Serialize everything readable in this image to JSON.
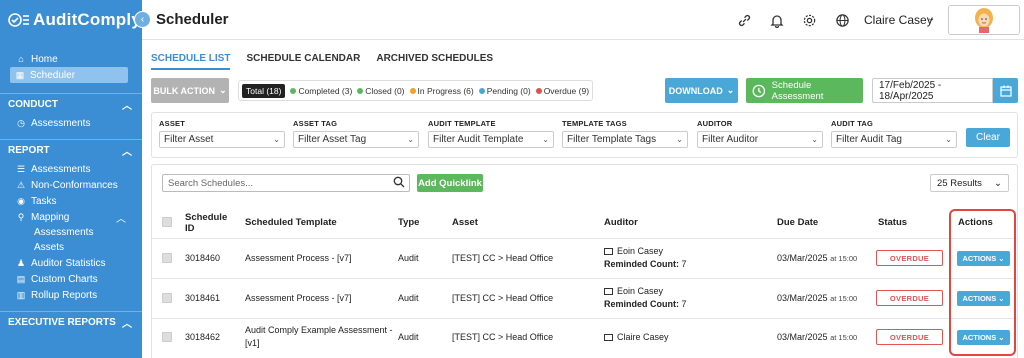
{
  "sidebar": {
    "brand": "AuditComply",
    "top_items": [
      {
        "label": "Home",
        "icon": "home-icon"
      },
      {
        "label": "Scheduler",
        "icon": "calendar-icon",
        "active": true
      }
    ],
    "conduct": {
      "title": "CONDUCT",
      "items": [
        {
          "label": "Assessments",
          "icon": "clock-icon"
        }
      ]
    },
    "report": {
      "title": "REPORT",
      "items": [
        {
          "label": "Assessments",
          "icon": "list-icon"
        },
        {
          "label": "Non-Conformances",
          "icon": "warning-icon"
        },
        {
          "label": "Tasks",
          "icon": "tasks-icon"
        },
        {
          "label": "Mapping",
          "icon": "map-pin-icon"
        }
      ],
      "mapping_sub": [
        "Assessments",
        "Assets"
      ],
      "items2": [
        {
          "label": "Auditor Statistics",
          "icon": "stats-icon"
        },
        {
          "label": "Custom Charts",
          "icon": "chart-icon"
        },
        {
          "label": "Rollup Reports",
          "icon": "rollup-icon"
        }
      ]
    },
    "executive": {
      "title": "EXECUTIVE REPORTS"
    }
  },
  "header": {
    "title": "Scheduler",
    "user_name": "Claire Casey"
  },
  "tabs": [
    "SCHEDULE LIST",
    "SCHEDULE CALENDAR",
    "ARCHIVED SCHEDULES"
  ],
  "toolbar": {
    "bulk_action": "BULK ACTION",
    "status": {
      "total": "Total (18)",
      "completed": "Completed (3)",
      "closed": "Closed (0)",
      "in_progress": "In Progress (6)",
      "pending": "Pending (0)",
      "overdue": "Overdue (9)"
    },
    "status_colors": {
      "completed": "#5cb85c",
      "closed": "#5cb85c",
      "in_progress": "#f0a030",
      "pending": "#4aa8d8",
      "overdue": "#d9534f"
    },
    "download": "DOWNLOAD",
    "schedule_assessment": "Schedule Assessment",
    "date_range": "17/Feb/2025 - 18/Apr/2025"
  },
  "filters": {
    "asset": {
      "label": "ASSET",
      "placeholder": "Filter Asset"
    },
    "asset_tag": {
      "label": "ASSET TAG",
      "placeholder": "Filter Asset Tag"
    },
    "audit_template": {
      "label": "AUDIT TEMPLATE",
      "placeholder": "Filter Audit Template"
    },
    "template_tags": {
      "label": "TEMPLATE TAGS",
      "placeholder": "Filter Template Tags"
    },
    "auditor": {
      "label": "AUDITOR",
      "placeholder": "Filter Auditor"
    },
    "audit_tag": {
      "label": "AUDIT TAG",
      "placeholder": "Filter Audit Tag"
    },
    "clear": "Clear"
  },
  "table": {
    "search_placeholder": "Search Schedules...",
    "add_quicklink": "Add Quicklink",
    "results": "25 Results",
    "headers": {
      "id1": "Schedule",
      "id2": "ID",
      "template": "Scheduled Template",
      "type": "Type",
      "asset": "Asset",
      "auditor": "Auditor",
      "due": "Due Date",
      "status": "Status",
      "actions": "Actions"
    },
    "rows": [
      {
        "id": "3018460",
        "template": "Assessment Process - [v7]",
        "type": "Audit",
        "asset": "[TEST] CC > Head Office",
        "auditor": "Eoin Casey",
        "reminded": "Reminded Count:",
        "reminded_count": "7",
        "due_date": "03/Mar/2025",
        "due_time": "at 15:00",
        "status": "OVERDUE",
        "action": "ACTIONS"
      },
      {
        "id": "3018461",
        "template": "Assessment Process - [v7]",
        "type": "Audit",
        "asset": "[TEST] CC > Head Office",
        "auditor": "Eoin Casey",
        "reminded": "Reminded Count:",
        "reminded_count": "7",
        "due_date": "03/Mar/2025",
        "due_time": "at 15:00",
        "status": "OVERDUE",
        "action": "ACTIONS"
      },
      {
        "id": "3018462",
        "template": "Audit Comply Example Assessment -",
        "template2": "[v1]",
        "type": "Audit",
        "asset": "[TEST] CC > Head Office",
        "auditor": "Claire Casey",
        "due_date": "03/Mar/2025",
        "due_time": "at 15:00",
        "status": "OVERDUE",
        "action": "ACTIONS"
      }
    ]
  }
}
